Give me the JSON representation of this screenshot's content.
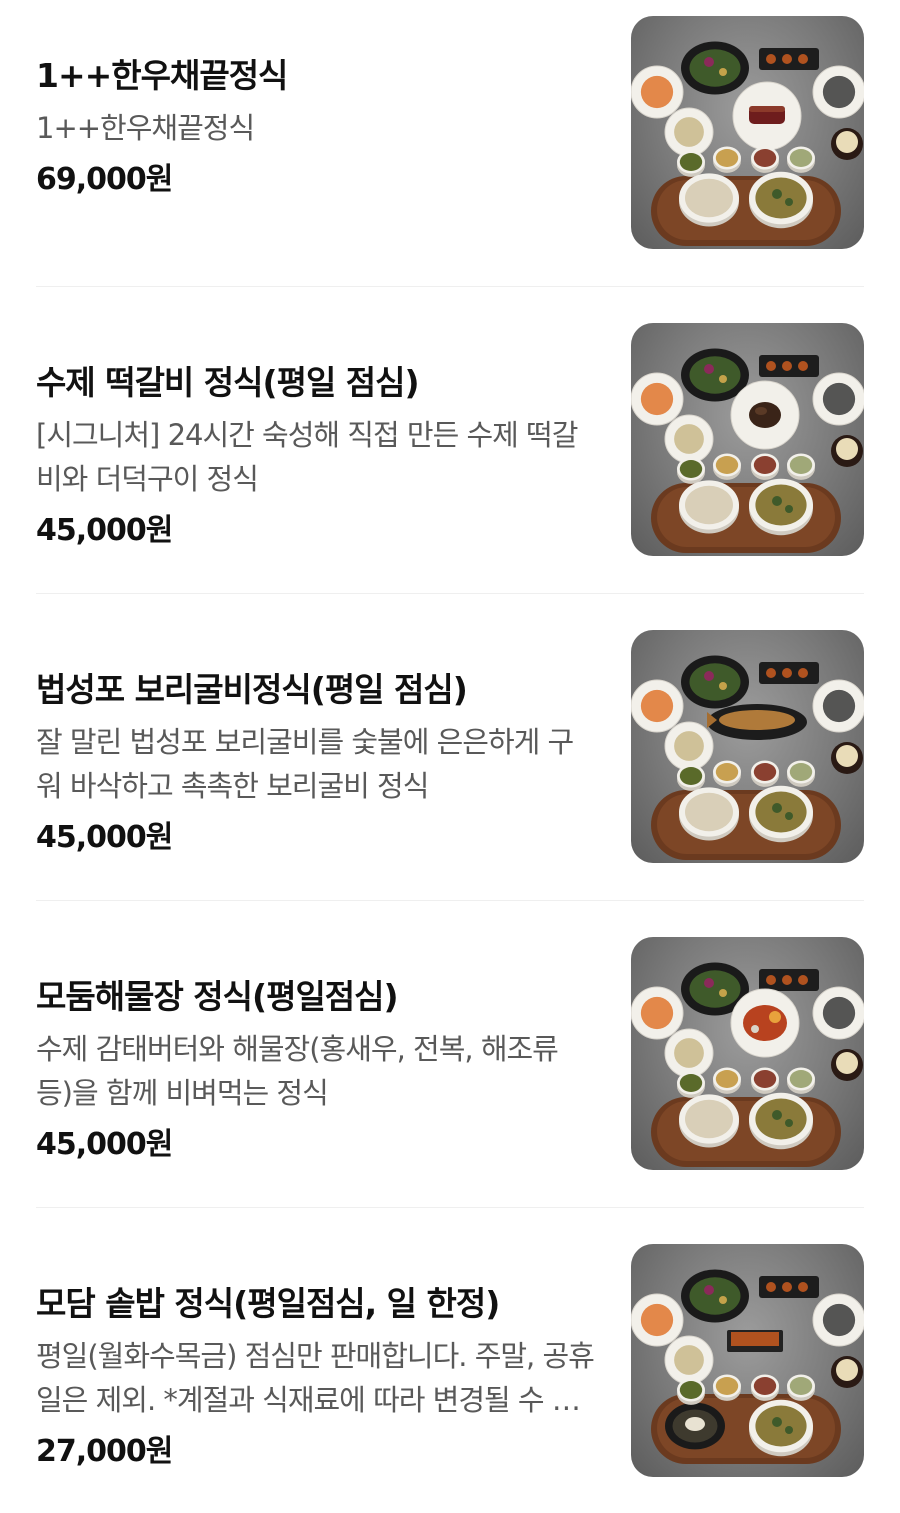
{
  "items": [
    {
      "name": "1++한우채끝정식",
      "description": "1++한우채끝정식",
      "price": "69,000원",
      "main_dish": "steak"
    },
    {
      "name": "수제 떡갈비 정식(평일 점심)",
      "description": "[시그니처] 24시간 숙성해 직접 만든 수제 떡갈비와 더덕구이 정식",
      "price": "45,000원",
      "main_dish": "patty"
    },
    {
      "name": "법성포 보리굴비정식(평일 점심)",
      "description": "잘 말린 법성포 보리굴비를 숯불에 은은하게 구워 바삭하고 촉촉한 보리굴비 정식",
      "price": "45,000원",
      "main_dish": "fish"
    },
    {
      "name": "모둠해물장 정식(평일점심)",
      "description": "수제 감태버터와 해물장(홍새우, 전복, 해조류 등)을 함께 비벼먹는 정식",
      "price": "45,000원",
      "main_dish": "seafood"
    },
    {
      "name": "모담 솥밥 정식(평일점심, 일 한정)",
      "description": "평일(월화수목금) 점심만 판매합니다. 주말, 공휴일은 제외. *계절과 식재료에 따라 변경될 수 있습니다.",
      "price": "27,000원",
      "main_dish": "pot-rice"
    }
  ],
  "colors": {
    "tray": "#6b3a1f",
    "plate": "#f2f0ea",
    "bowl_rim": "#1a1a1a",
    "greens": "#3f5a2a",
    "soup": "#8a7a3a",
    "carrot": "#e0762e"
  }
}
